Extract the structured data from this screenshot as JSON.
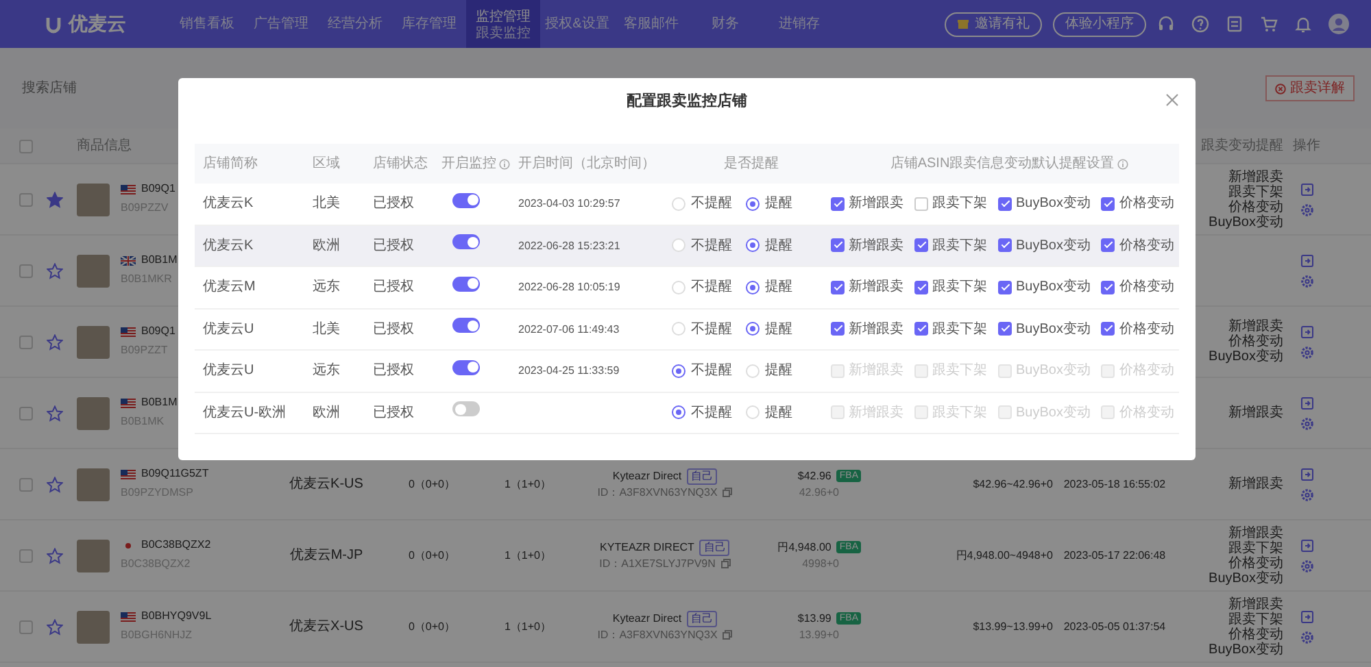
{
  "app": {
    "logo": "优麦云",
    "nav": [
      {
        "label": "销售看板",
        "selected": false
      },
      {
        "label": "广告管理",
        "selected": false
      },
      {
        "label": "经营分析",
        "selected": false
      },
      {
        "label": "库存管理",
        "selected": false
      },
      {
        "label": "监控管理",
        "sub": "跟卖监控",
        "selected": true
      },
      {
        "label": "授权&设置",
        "selected": false
      },
      {
        "label": "客服邮件",
        "selected": false
      },
      {
        "label": "财务",
        "selected": false
      },
      {
        "label": "进销存",
        "selected": false
      }
    ],
    "invite_button": "邀请有礼",
    "miniapp_button": "体验小程序"
  },
  "toolbar": {
    "search": {
      "placeholder": "搜索店铺"
    },
    "guide_button": "跟卖详解"
  },
  "table": {
    "all_selected": false,
    "columns": [
      "商品信息",
      "跟卖变动提醒",
      "操作"
    ],
    "rows": [
      {
        "selected": false,
        "starred": true,
        "kind": "us",
        "asin": "B09Q1",
        "parent_asin": "B09PZZV",
        "reminders": [
          "新增跟卖",
          "跟卖下架",
          "价格变动",
          "BuyBox变动"
        ]
      },
      {
        "selected": false,
        "starred": false,
        "kind": "uk",
        "asin": "B0B1M",
        "parent_asin": "B0B1MKR",
        "reminders": []
      },
      {
        "selected": false,
        "starred": false,
        "kind": "us",
        "asin": "B09Q1",
        "parent_asin": "B09PZZT",
        "reminders": [
          "新增跟卖",
          "价格变动",
          "BuyBox变动"
        ]
      },
      {
        "selected": false,
        "starred": false,
        "kind": "us",
        "asin": "B0B1M",
        "parent_asin": "B0B1MK",
        "reminders": [
          "新增跟卖"
        ]
      },
      {
        "selected": false,
        "starred": false,
        "kind": "us",
        "asin": "B09Q11G5ZT",
        "parent_asin": "B09PZYDMSP",
        "store": "优麦云K-US",
        "offers": "0（0+0）",
        "sellers": "1（1+0）",
        "seller": "Kyteazr Direct",
        "seller_tag": "自己",
        "seller_id": "ID：A3F8XVN63YNQ3X",
        "price": "$42.96",
        "fulfillment": "FBA",
        "price_detail": "42.96+0",
        "price_range": "$42.96~42.96+0",
        "updated": "2023-05-18 16:55:02",
        "reminders": [
          "新增跟卖"
        ]
      },
      {
        "selected": false,
        "starred": false,
        "kind": "jp",
        "asin": "B0C38BQZX2",
        "parent_asin": "B0C38BQZX2",
        "store": "优麦云M-JP",
        "offers": "0（0+0）",
        "sellers": "1（1+0）",
        "seller": "KYTEAZR DIRECT",
        "seller_tag": "自己",
        "seller_id": "ID：A1XE7SLYJ7PV9N",
        "price": "円4,948.00",
        "fulfillment": "FBA",
        "price_detail": "4998+0",
        "price_range": "円4,948.00~4948+0",
        "updated": "2023-05-17 22:06:48",
        "reminders": [
          "新增跟卖",
          "跟卖下架",
          "价格变动",
          "BuyBox变动"
        ]
      },
      {
        "selected": false,
        "starred": false,
        "kind": "us",
        "asin": "B0BHYQ9V9L",
        "parent_asin": "B0BGH6NHJZ",
        "store": "优麦云X-US",
        "offers": "0（0+0）",
        "sellers": "1（1+0）",
        "seller": "Kyteazr Direct",
        "seller_tag": "自己",
        "seller_id": "ID：A3F8XVN63YNQ3X",
        "price": "$13.99",
        "fulfillment": "FBA",
        "price_detail": "13.99+0",
        "price_range": "$13.99~13.99+0",
        "updated": "2023-05-05 01:37:54",
        "reminders": [
          "新增跟卖",
          "跟卖下架",
          "价格变动",
          "BuyBox变动"
        ]
      }
    ]
  },
  "modal": {
    "title": "配置跟卖监控店铺",
    "columns": [
      {
        "label": "店铺简称"
      },
      {
        "label": "区域"
      },
      {
        "label": "店铺状态"
      },
      {
        "label": "开启监控",
        "info": true
      },
      {
        "label": "开启时间（北京时间）"
      },
      {
        "label": "是否提醒"
      },
      {
        "label": "店铺ASIN跟卖信息变动默认提醒设置",
        "info": true
      }
    ],
    "rows": [
      {
        "store": "优麦云K",
        "region": "北美",
        "status": "已授权",
        "monitoring": true,
        "start_time": "2023-04-03 10:29:57",
        "highlighted": false,
        "remind": [
          {
            "label": "不提醒",
            "selected": false
          },
          {
            "label": "提醒",
            "selected": true
          }
        ],
        "alerts": [
          {
            "label": "新增跟卖",
            "checked": true,
            "disabled": false
          },
          {
            "label": "跟卖下架",
            "checked": false,
            "disabled": false
          },
          {
            "label": "BuyBox变动",
            "checked": true,
            "disabled": false
          },
          {
            "label": "价格变动",
            "checked": true,
            "disabled": false
          }
        ]
      },
      {
        "store": "优麦云K",
        "region": "欧洲",
        "status": "已授权",
        "monitoring": true,
        "start_time": "2022-06-28 15:23:21",
        "highlighted": true,
        "remind": [
          {
            "label": "不提醒",
            "selected": false
          },
          {
            "label": "提醒",
            "selected": true
          }
        ],
        "alerts": [
          {
            "label": "新增跟卖",
            "checked": true,
            "disabled": false
          },
          {
            "label": "跟卖下架",
            "checked": true,
            "disabled": false
          },
          {
            "label": "BuyBox变动",
            "checked": true,
            "disabled": false
          },
          {
            "label": "价格变动",
            "checked": true,
            "disabled": false
          }
        ]
      },
      {
        "store": "优麦云M",
        "region": "远东",
        "status": "已授权",
        "monitoring": true,
        "start_time": "2022-06-28 10:05:19",
        "highlighted": false,
        "remind": [
          {
            "label": "不提醒",
            "selected": false
          },
          {
            "label": "提醒",
            "selected": true
          }
        ],
        "alerts": [
          {
            "label": "新增跟卖",
            "checked": true,
            "disabled": false
          },
          {
            "label": "跟卖下架",
            "checked": true,
            "disabled": false
          },
          {
            "label": "BuyBox变动",
            "checked": true,
            "disabled": false
          },
          {
            "label": "价格变动",
            "checked": true,
            "disabled": false
          }
        ]
      },
      {
        "store": "优麦云U",
        "region": "北美",
        "status": "已授权",
        "monitoring": true,
        "start_time": "2022-07-06 11:49:43",
        "highlighted": false,
        "remind": [
          {
            "label": "不提醒",
            "selected": false
          },
          {
            "label": "提醒",
            "selected": true
          }
        ],
        "alerts": [
          {
            "label": "新增跟卖",
            "checked": true,
            "disabled": false
          },
          {
            "label": "跟卖下架",
            "checked": true,
            "disabled": false
          },
          {
            "label": "BuyBox变动",
            "checked": true,
            "disabled": false
          },
          {
            "label": "价格变动",
            "checked": true,
            "disabled": false
          }
        ]
      },
      {
        "store": "优麦云U",
        "region": "远东",
        "status": "已授权",
        "monitoring": true,
        "start_time": "2023-04-25 11:33:59",
        "highlighted": false,
        "remind": [
          {
            "label": "不提醒",
            "selected": true
          },
          {
            "label": "提醒",
            "selected": false
          }
        ],
        "alerts": [
          {
            "label": "新增跟卖",
            "checked": false,
            "disabled": true
          },
          {
            "label": "跟卖下架",
            "checked": false,
            "disabled": true
          },
          {
            "label": "BuyBox变动",
            "checked": false,
            "disabled": true
          },
          {
            "label": "价格变动",
            "checked": false,
            "disabled": true
          }
        ]
      },
      {
        "store": "优麦云U-欧洲",
        "region": "欧洲",
        "status": "已授权",
        "monitoring": false,
        "highlighted": false,
        "remind": [
          {
            "label": "不提醒",
            "selected": true
          },
          {
            "label": "提醒",
            "selected": false
          }
        ],
        "alerts": [
          {
            "label": "新增跟卖",
            "checked": false,
            "disabled": true
          },
          {
            "label": "跟卖下架",
            "checked": false,
            "disabled": true
          },
          {
            "label": "BuyBox变动",
            "checked": false,
            "disabled": true
          },
          {
            "label": "价格变动",
            "checked": false,
            "disabled": true
          }
        ]
      }
    ]
  }
}
